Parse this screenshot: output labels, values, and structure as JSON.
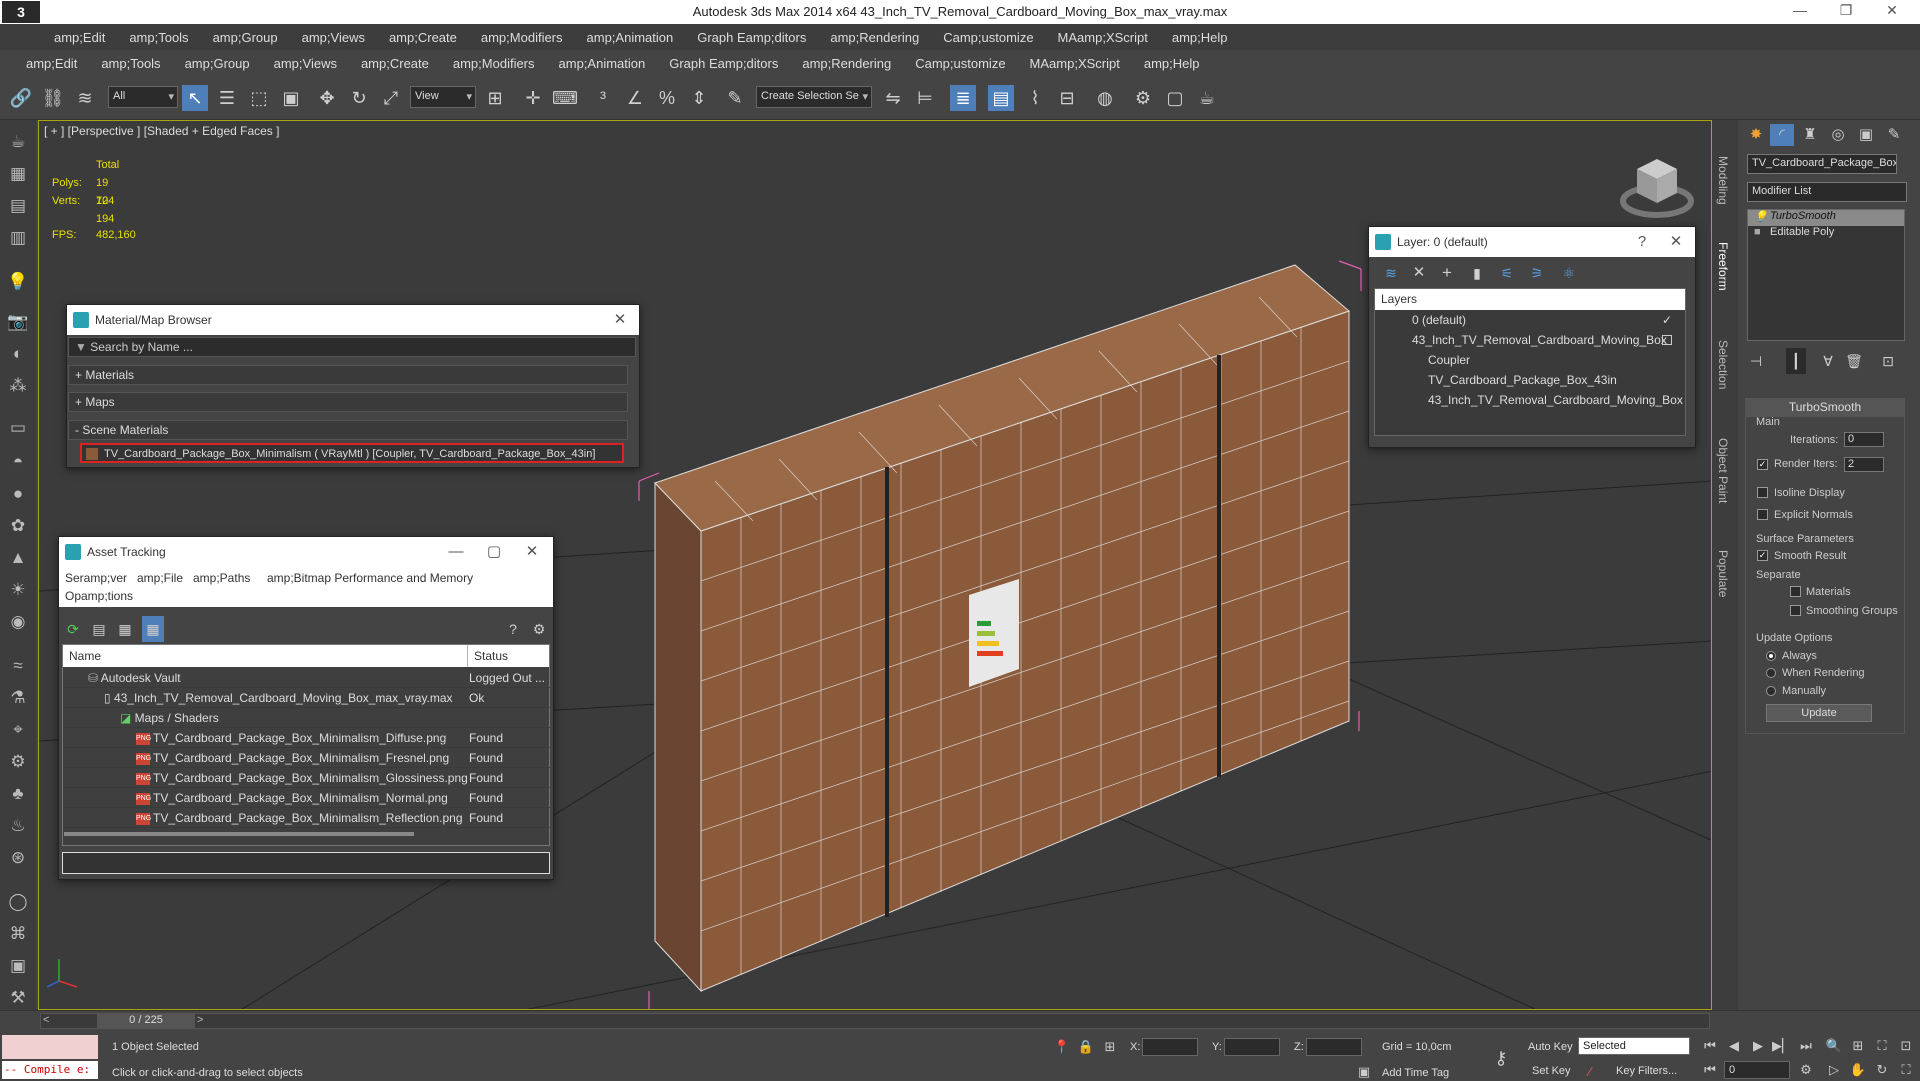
{
  "app": {
    "logo": "3",
    "title": "Autodesk 3ds Max  2014 x64     43_Inch_TV_Removal_Cardboard_Moving_Box_max_vray.max"
  },
  "menu_top": [
    "amp;Edit",
    "amp;Tools",
    "amp;Group",
    "amp;Views",
    "amp;Create",
    "amp;Modifiers",
    "amp;Animation",
    "Graph Eamp;ditors",
    "amp;Rendering",
    "Camp;ustomize",
    "MAamp;XScript",
    "amp;Help"
  ],
  "menu_second": [
    "amp;Edit",
    "amp;Tools",
    "amp;Group",
    "amp;Views",
    "amp;Create",
    "amp;Modifiers",
    "amp;Animation",
    "Graph Eamp;ditors",
    "amp;Rendering",
    "Camp;ustomize",
    "MAamp;XScript",
    "amp;Help"
  ],
  "toolbar": {
    "filter_value": "All",
    "ref_coord_value": "View",
    "selection_set_placeholder": "Create Selection Se"
  },
  "viewport": {
    "label": "[ + ] [Perspective ] [Shaded + Edged Faces ]",
    "stats_total": "Total",
    "polys_label": "Polys:",
    "polys_value": "19 724",
    "verts_label": "Verts:",
    "verts_value": "10 194",
    "fps_label": "FPS:",
    "fps_value": "482,160"
  },
  "side_tabs": [
    "Modeling",
    "Freeform",
    "Selection",
    "Object Paint",
    "Populate"
  ],
  "command_panel": {
    "object_name": "TV_Cardboard_Package_Box",
    "modifier_list": "Modifier List",
    "stack": [
      "TurboSmooth",
      "Editable Poly"
    ],
    "rollout_title": "TurboSmooth",
    "main_label": "Main",
    "iterations_label": "Iterations:",
    "iterations_value": "0",
    "render_iters_label": "Render Iters:",
    "render_iters_value": "2",
    "isoline_label": "Isoline Display",
    "explicit_normals_label": "Explicit Normals",
    "surface_params_label": "Surface Parameters",
    "smooth_result_label": "Smooth Result",
    "separate_label": "Separate",
    "materials_label": "Materials",
    "smoothing_groups_label": "Smoothing Groups",
    "update_options_label": "Update Options",
    "always_label": "Always",
    "when_rendering_label": "When Rendering",
    "manually_label": "Manually",
    "update_button": "Update"
  },
  "material_browser": {
    "title": "Material/Map Browser",
    "search_placeholder": "Search by Name ...",
    "materials": "+ Materials",
    "maps": "+ Maps",
    "scene_materials": "- Scene Materials",
    "scene_item": "TV_Cardboard_Package_Box_Minimalism  ( VRayMtl ) [Coupler, TV_Cardboard_Package_Box_43in]"
  },
  "layer_window": {
    "title": "Layer: 0 (default)",
    "help": "?",
    "column": "Layers",
    "rows": [
      "0 (default)",
      "43_Inch_TV_Removal_Cardboard_Moving_Box",
      "Coupler",
      "TV_Cardboard_Package_Box_43in",
      "43_Inch_TV_Removal_Cardboard_Moving_Box"
    ]
  },
  "asset_tracking": {
    "title": "Asset Tracking",
    "menu": [
      "Seramp;ver",
      "amp;File",
      "amp;Paths",
      "amp;Bitmap Performance and Memory",
      "Opamp;tions"
    ],
    "col_name": "Name",
    "col_status": "Status",
    "rows": [
      {
        "name": "Autodesk Vault",
        "status": "Logged Out ..."
      },
      {
        "name": "43_Inch_TV_Removal_Cardboard_Moving_Box_max_vray.max",
        "status": "Ok"
      },
      {
        "name": "Maps / Shaders",
        "status": ""
      },
      {
        "name": "TV_Cardboard_Package_Box_Minimalism_Diffuse.png",
        "status": "Found"
      },
      {
        "name": "TV_Cardboard_Package_Box_Minimalism_Fresnel.png",
        "status": "Found"
      },
      {
        "name": "TV_Cardboard_Package_Box_Minimalism_Glossiness.png",
        "status": "Found"
      },
      {
        "name": "TV_Cardboard_Package_Box_Minimalism_Normal.png",
        "status": "Found"
      },
      {
        "name": "TV_Cardboard_Package_Box_Minimalism_Reflection.png",
        "status": "Found"
      }
    ],
    "png_badge": "PNG"
  },
  "status": {
    "frame": "0 / 225",
    "maxscript": "-- Compile e:",
    "selected": "1 Object Selected",
    "prompt": "Click or click-and-drag to select objects",
    "x_label": "X:",
    "y_label": "Y:",
    "z_label": "Z:",
    "grid": "Grid = 10,0cm",
    "auto_key": "Auto Key",
    "set_key": "Set Key",
    "selected_combo": "Selected",
    "key_filters": "Key Filters...",
    "add_time_tag": "Add Time Tag",
    "frame_field": "0"
  },
  "colors": {
    "accent": "#4f7fb8",
    "viewport_border": "#aaa50f",
    "stats_yellow": "#e8e000",
    "box_brown": "#8a5a3a",
    "selection_pink": "#e060b0"
  }
}
